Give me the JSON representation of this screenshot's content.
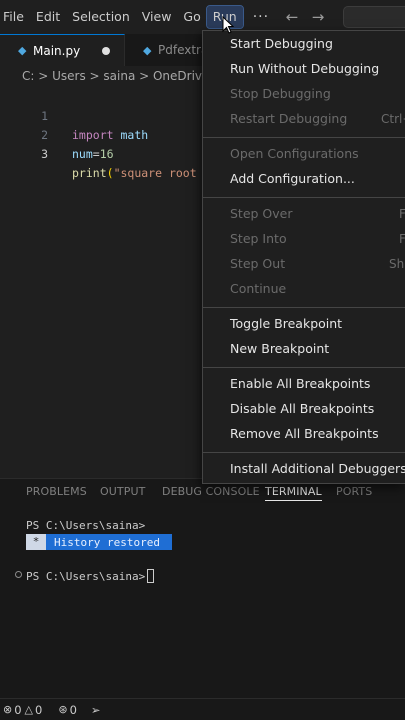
{
  "menubar": {
    "items": [
      "File",
      "Edit",
      "Selection",
      "View",
      "Go",
      "Run"
    ],
    "more": "···",
    "back_arrow": "←",
    "forward_arrow": "→"
  },
  "tabs": [
    {
      "label": "Main.py",
      "icon": "python-file-icon",
      "modified": true
    },
    {
      "label": "Pdfextrac",
      "icon": "python-file-icon",
      "modified": false
    }
  ],
  "breadcrumb": "C: > Users > saina > OneDrive >",
  "editor": {
    "lines": [
      {
        "number": "1",
        "tokens": [
          [
            "kw",
            "import"
          ],
          [
            "plain",
            " "
          ],
          [
            "id",
            "math"
          ]
        ]
      },
      {
        "number": "2",
        "tokens": [
          [
            "id",
            "num"
          ],
          [
            "plain",
            "="
          ],
          [
            "num",
            "16"
          ]
        ]
      },
      {
        "number": "3",
        "tokens": [
          [
            "fn",
            "print"
          ],
          [
            "pn",
            "("
          ],
          [
            "str",
            "\"square root"
          ]
        ]
      }
    ]
  },
  "run_menu": {
    "items": [
      {
        "label": "Start Debugging",
        "enabled": true
      },
      {
        "label": "Run Without Debugging",
        "enabled": true
      },
      {
        "label": "Stop Debugging",
        "enabled": false
      },
      {
        "label": "Restart Debugging",
        "enabled": false,
        "shortcut": "Ctrl+"
      },
      {
        "label": "Open Configurations",
        "enabled": false
      },
      {
        "label": "Add Configuration...",
        "enabled": true
      },
      {
        "label": "Step Over",
        "enabled": false,
        "shortcut": "F"
      },
      {
        "label": "Step Into",
        "enabled": false,
        "shortcut": "F"
      },
      {
        "label": "Step Out",
        "enabled": false,
        "shortcut": "Sh"
      },
      {
        "label": "Continue",
        "enabled": false
      },
      {
        "label": "Toggle Breakpoint",
        "enabled": true
      },
      {
        "label": "New Breakpoint",
        "enabled": true
      },
      {
        "label": "Enable All Breakpoints",
        "enabled": true
      },
      {
        "label": "Disable All Breakpoints",
        "enabled": true
      },
      {
        "label": "Remove All Breakpoints",
        "enabled": true
      },
      {
        "label": "Install Additional Debuggers...",
        "enabled": true
      }
    ]
  },
  "panel": {
    "tabs": [
      "PROBLEMS",
      "OUTPUT",
      "DEBUG CONSOLE",
      "TERMINAL",
      "PORTS"
    ],
    "active_tab": "TERMINAL",
    "terminal": {
      "line1": "PS C:\\Users\\saina>",
      "history_marker": "*",
      "history_text": "History restored",
      "prompt": "PS C:\\Users\\saina>"
    }
  },
  "statusbar": {
    "errors": "0",
    "warnings": "0",
    "ports": "0"
  },
  "colors": {
    "accent": "#0078d4",
    "background": "#1f1f1f",
    "history_bg": "#1f6ed4"
  }
}
